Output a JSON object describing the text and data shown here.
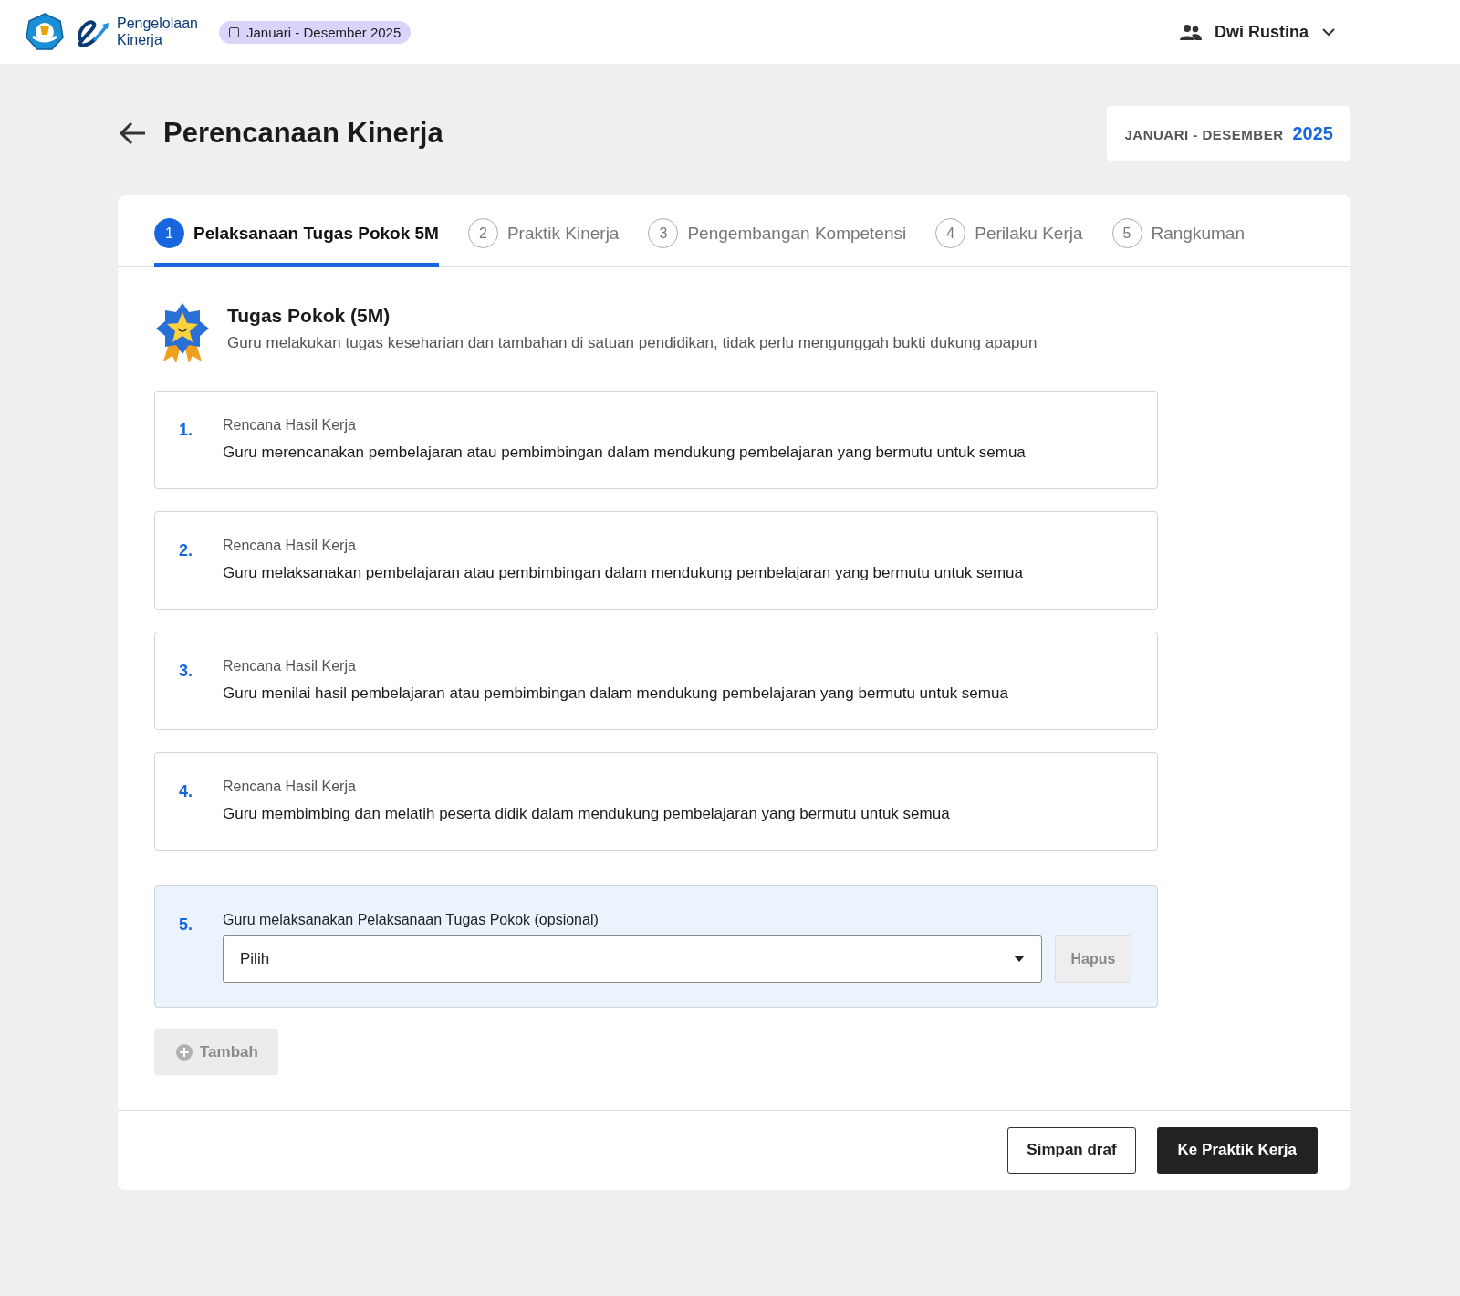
{
  "header": {
    "logo_text": "Pengelolaan Kinerja",
    "period_chip": "Januari - Desember 2025",
    "user": "Dwi Rustina"
  },
  "page": {
    "title": "Perencanaan Kinerja",
    "period_label": "JANUARI - DESEMBER",
    "period_year": "2025"
  },
  "tabs": [
    {
      "number": "1",
      "label": "Pelaksanaan Tugas Pokok 5M",
      "selected": true
    },
    {
      "number": "2",
      "label": "Praktik Kinerja",
      "selected": false
    },
    {
      "number": "3",
      "label": "Pengembangan Kompetensi",
      "selected": false
    },
    {
      "number": "4",
      "label": "Perilaku Kerja",
      "selected": false
    },
    {
      "number": "5",
      "label": "Rangkuman",
      "selected": false
    }
  ],
  "section": {
    "title": "Tugas Pokok (5M)",
    "description": "Guru melakukan tugas keseharian dan tambahan di satuan pendidikan, tidak perlu mengunggah bukti dukung apapun"
  },
  "items": [
    {
      "kind": "plan",
      "number": "1.",
      "label": "Rencana Hasil Kerja",
      "text": "Guru merencanakan pembelajaran atau pembimbingan dalam mendukung pembelajaran yang bermutu untuk semua"
    },
    {
      "kind": "plan",
      "number": "2.",
      "label": "Rencana Hasil Kerja",
      "text": "Guru melaksanakan pembelajaran atau pembimbingan dalam mendukung pembelajaran yang bermutu untuk semua"
    },
    {
      "kind": "plan",
      "number": "3.",
      "label": "Rencana Hasil Kerja",
      "text": "Guru menilai hasil pembelajaran atau pembimbingan dalam mendukung pembelajaran yang bermutu untuk semua"
    },
    {
      "kind": "plan",
      "number": "4.",
      "label": "Rencana Hasil Kerja",
      "text": "Guru membimbing dan melatih peserta didik dalam mendukung pembelajaran yang bermutu untuk semua"
    },
    {
      "kind": "select",
      "number": "5.",
      "label": "Guru melaksanakan Pelaksanaan Tugas Pokok (opsional)",
      "value": "Pilih",
      "remove_button": {
        "label": "Hapus",
        "disabled": true
      }
    }
  ],
  "add_button": {
    "label": "Tambah",
    "disabled": true
  },
  "footer": {
    "buttons": [
      {
        "kind": "secondary",
        "label": "Simpan draf"
      },
      {
        "kind": "primary",
        "label": "Ke Praktik Kerja"
      }
    ]
  }
}
